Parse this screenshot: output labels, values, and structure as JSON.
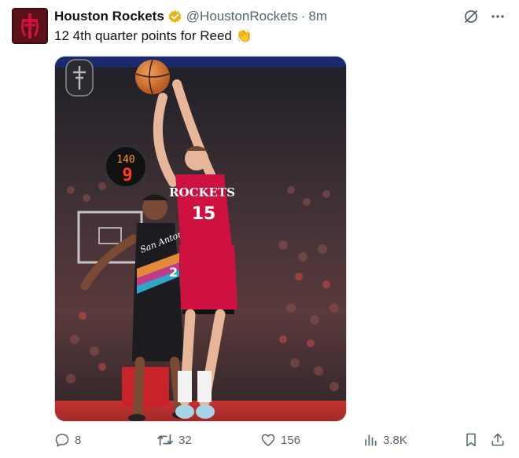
{
  "author": {
    "name": "Houston Rockets",
    "handle": "@HoustonRockets",
    "separator": "·",
    "time": "8m",
    "avatar_icon": "rockets-logo-icon",
    "verified_icon": "verified-badge-icon"
  },
  "tweet": {
    "text": "12 4th quarter points for Reed 👏"
  },
  "media": {
    "scoreboard_top": "140",
    "scoreboard_bottom": "9",
    "jersey_home_name": "ROCKETS",
    "jersey_home_number": "15",
    "jersey_away_name": "San Antonio",
    "jersey_away_number": "2"
  },
  "actions": {
    "replies": "8",
    "retweets": "32",
    "likes": "156",
    "views": "3.8K"
  },
  "colors": {
    "text": "#0f1419",
    "muted": "#536471",
    "verified": "#e2b719",
    "rockets_red": "#ce1141"
  }
}
